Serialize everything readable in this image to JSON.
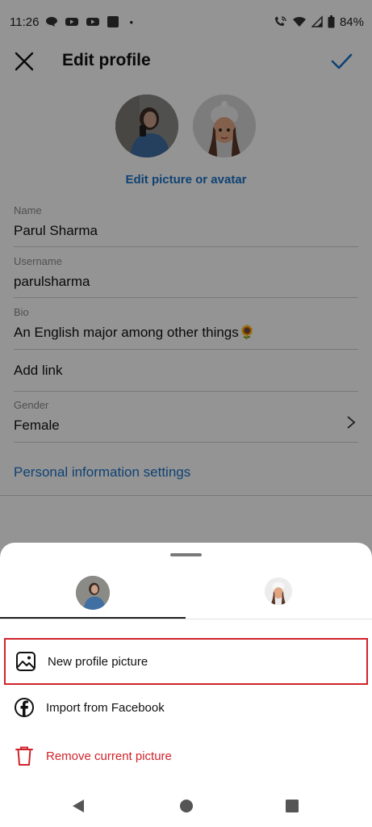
{
  "status_bar": {
    "time": "11:26",
    "dot": "•",
    "battery": "84%",
    "icons": [
      "chat-bubble-icon",
      "youtube-icon",
      "youtube-icon",
      "app-square-icon",
      "wifi-call-icon",
      "wifi-icon",
      "signal-icon",
      "battery-icon"
    ]
  },
  "header": {
    "title": "Edit profile",
    "close_icon": "close-icon",
    "save_icon": "check-icon"
  },
  "profile": {
    "edit_picture_label": "Edit picture or avatar"
  },
  "fields": {
    "name_label": "Name",
    "name_value": "Parul Sharma",
    "username_label": "Username",
    "username_value": "parulsharma",
    "bio_label": "Bio",
    "bio_value": "An English major among other things🌻",
    "add_link": "Add link",
    "gender_label": "Gender",
    "gender_value": "Female"
  },
  "personal_info_link": "Personal information settings",
  "sheet": {
    "tabs": [
      "Profile picture",
      "Avatar"
    ],
    "options": [
      {
        "label": "New profile picture",
        "icon": "image-icon"
      },
      {
        "label": "Import from Facebook",
        "icon": "facebook-icon"
      },
      {
        "label": "Remove current picture",
        "icon": "trash-icon"
      }
    ]
  },
  "colors": {
    "accent": "#1a73c8",
    "danger": "#d0232b",
    "highlight_border": "#d0232b"
  },
  "nav": [
    "back-icon",
    "home-icon",
    "recents-icon"
  ]
}
